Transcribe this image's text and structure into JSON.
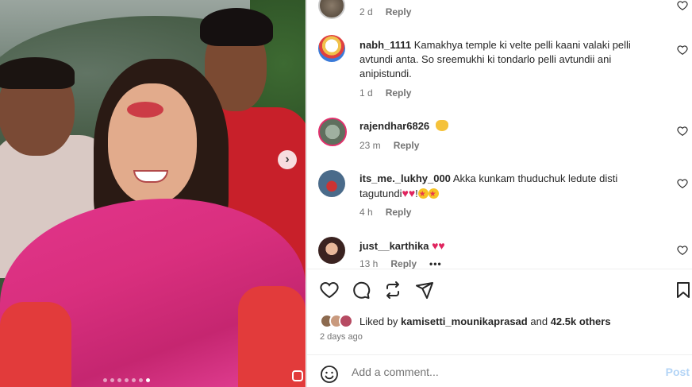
{
  "comments": [
    {
      "username": "",
      "text": "",
      "time": "2 d",
      "reply_label": "Reply"
    },
    {
      "username": "nabh_1111",
      "text": "Kamakhya temple ki velte pelli kaani valaki pelli avtundi anta. So sreemukhi ki tondarlo pelli avtundii ani anipistundi.",
      "time": "1 d",
      "reply_label": "Reply"
    },
    {
      "username": "rajendhar6826",
      "text": "",
      "emoji": "hands-icon",
      "time": "23 m",
      "reply_label": "Reply"
    },
    {
      "username": "its_me._lukhy_000",
      "text": "Akka kunkam thuduchuk ledute disti tagutundi",
      "emoji_after": "❤️❤️!🤩🤩",
      "time": "4 h",
      "reply_label": "Reply"
    },
    {
      "username": "just__karthika",
      "text": "",
      "emoji_after": "❤️❤️",
      "time": "13 h",
      "reply_label": "Reply",
      "more": "•••"
    }
  ],
  "likes": {
    "prefix": "Liked by",
    "user": "kamisetti_mounikaprasad",
    "joiner": "and",
    "count": "42.5k others"
  },
  "post_date": "2 days ago",
  "add_comment": {
    "placeholder": "Add a comment...",
    "post_label": "Post"
  },
  "carousel": {
    "total_dots": 7,
    "active_dot": 6
  },
  "colors": {
    "heart": "#e0245e",
    "post_disabled": "#b3d4f6",
    "meta_gray": "#737373"
  }
}
